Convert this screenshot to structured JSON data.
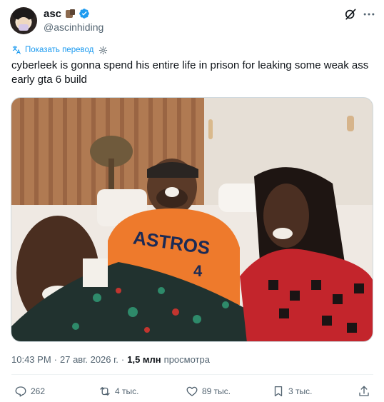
{
  "author": {
    "display_name": "asc",
    "handle": "@ascinhiding"
  },
  "translate": {
    "label": "Показать перевод"
  },
  "tweet": {
    "text": "cyberleek is gonna spend his entire life in prison for leaking some weak ass early gta 6 build"
  },
  "media": {
    "jersey_text": "ASTROS",
    "jersey_number": "4"
  },
  "meta": {
    "time": "10:43 PM",
    "separator": "·",
    "date": "27 авг. 2026 г.",
    "separator2": "·",
    "views_count": "1,5 млн",
    "views_label": "просмотра"
  },
  "actions": {
    "replies": "262",
    "retweets": "4 тыс.",
    "likes": "89 тыс.",
    "bookmarks": "3 тыс."
  },
  "colors": {
    "accent": "#1d9bf0",
    "muted": "#536471",
    "text": "#0f1419",
    "verified": "#1d9bf0"
  },
  "icons": [
    "verified-icon",
    "grok-icon",
    "more-icon",
    "globe-icon",
    "gear-icon",
    "reply-icon",
    "retweet-icon",
    "like-icon",
    "bookmark-icon",
    "share-icon"
  ]
}
